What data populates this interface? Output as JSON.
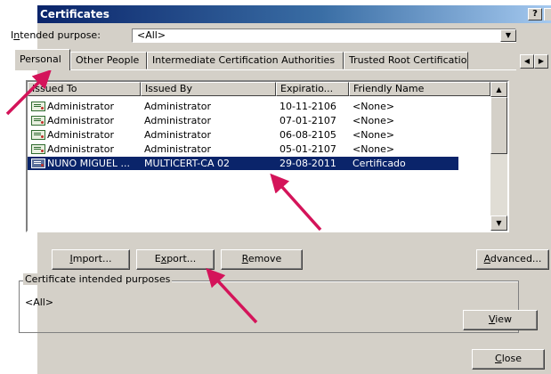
{
  "window": {
    "title": "Certificates",
    "help_glyph": "?"
  },
  "intended_purpose": {
    "label_prefix": "I",
    "label_underlined": "n",
    "label_rest": "tended purpose:",
    "value": "<All>"
  },
  "tabs": [
    {
      "label": "Personal"
    },
    {
      "label": "Other People"
    },
    {
      "label": "Intermediate Certification Authorities"
    },
    {
      "label": "Trusted Root Certification"
    }
  ],
  "columns": [
    "Issued To",
    "Issued By",
    "Expiratio...",
    "Friendly Name"
  ],
  "rows": [
    {
      "issued_to": "Administrator",
      "issued_by": "Administrator",
      "expiration": "10-11-2106",
      "friendly": "<None>"
    },
    {
      "issued_to": "Administrator",
      "issued_by": "Administrator",
      "expiration": "07-01-2107",
      "friendly": "<None>"
    },
    {
      "issued_to": "Administrator",
      "issued_by": "Administrator",
      "expiration": "06-08-2105",
      "friendly": "<None>"
    },
    {
      "issued_to": "Administrator",
      "issued_by": "Administrator",
      "expiration": "05-01-2107",
      "friendly": "<None>"
    },
    {
      "issued_to": "NUNO MIGUEL ...",
      "issued_by": "MULTICERT-CA 02",
      "expiration": "29-08-2011",
      "friendly": "Certificado",
      "selected": true
    }
  ],
  "buttons": {
    "import": {
      "u": "I",
      "rest": "mport..."
    },
    "export": {
      "pre": "E",
      "u": "x",
      "rest": "port..."
    },
    "remove": {
      "u": "R",
      "rest": "emove"
    },
    "advanced": {
      "u": "A",
      "rest": "dvanced..."
    },
    "view": {
      "u": "V",
      "rest": "iew"
    },
    "close": {
      "u": "C",
      "rest": "lose"
    }
  },
  "purposes": {
    "title": "Certificate intended purposes",
    "value": "<All>"
  },
  "colors": {
    "accent_arrow": "#d4145a",
    "selection": "#0a246a",
    "dialog_bg": "#d4d0c8"
  }
}
